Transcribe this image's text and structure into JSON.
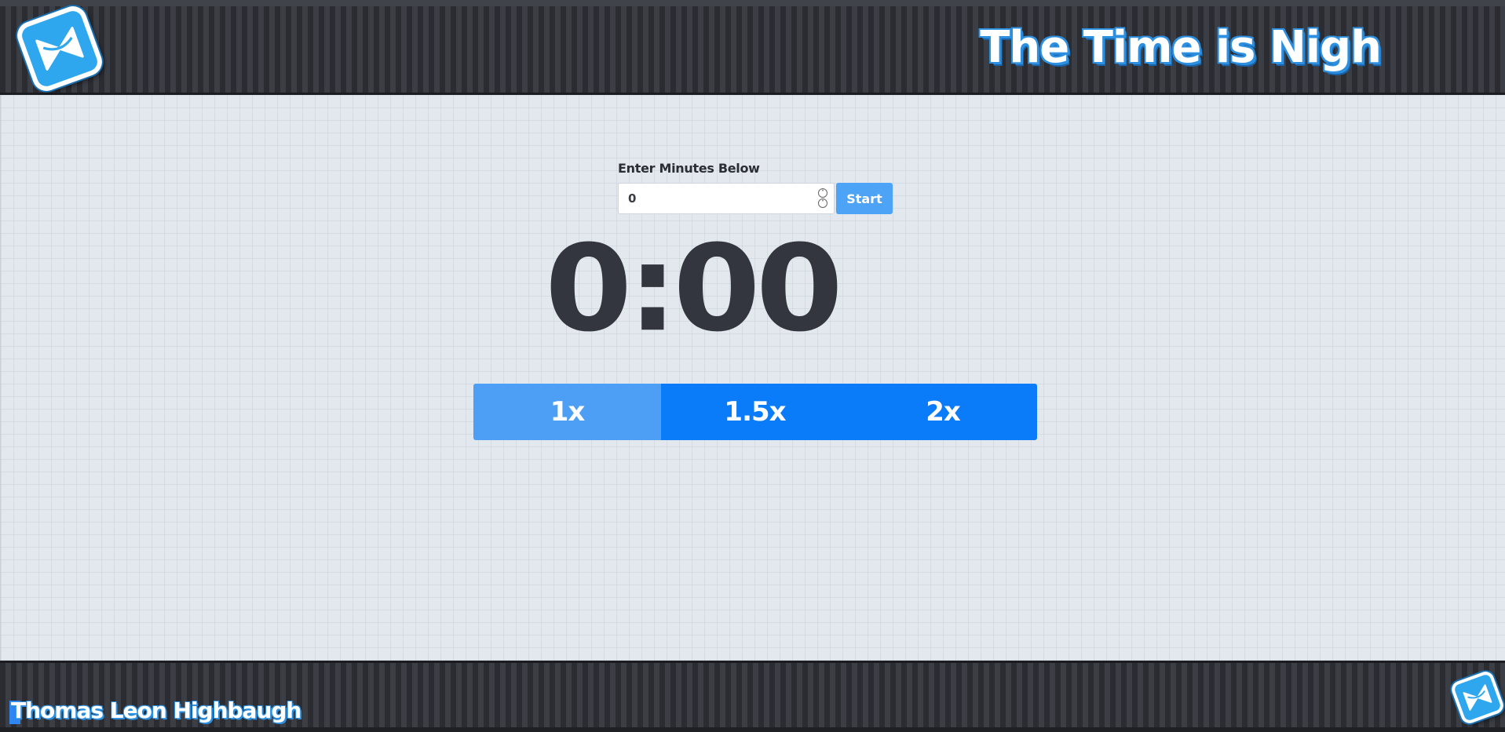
{
  "header": {
    "title": "The Time is Nigh",
    "logo_icon": "bowtie-hourglass-icon"
  },
  "timer_form": {
    "label": "Enter Minutes Below",
    "minutes_value": "0",
    "start_label": "Start",
    "stepper_up": "˄",
    "stepper_down": "˅"
  },
  "timer": {
    "display": "0:00"
  },
  "speed": {
    "options": [
      "1x",
      "1.5x",
      "2x"
    ],
    "selected": "1x"
  },
  "footer": {
    "author": "Thomas Leon Highbaugh",
    "logo_icon": "bowtie-hourglass-icon"
  },
  "colors": {
    "accent": "#0a7cf9",
    "accent_selected": "#4d9ff6",
    "start_button": "#4da3f5",
    "header_bg": "#33363c",
    "main_bg": "#e2e8ee",
    "timer_text": "#33363e"
  }
}
